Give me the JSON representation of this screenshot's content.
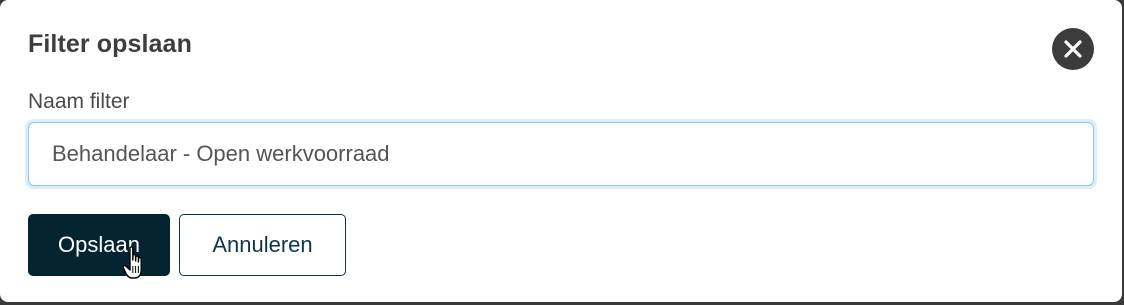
{
  "dialog": {
    "title": "Filter opslaan",
    "close_icon": "close-icon"
  },
  "form": {
    "name_label": "Naam filter",
    "name_value": "Behandelaar - Open werkvoorraad"
  },
  "actions": {
    "save_label": "Opslaan",
    "cancel_label": "Annuleren"
  },
  "colors": {
    "primary": "#052432",
    "focus_border": "#8fc6ee",
    "close_bg": "#3c3c3c"
  },
  "pointer": "hand-pointer-icon"
}
